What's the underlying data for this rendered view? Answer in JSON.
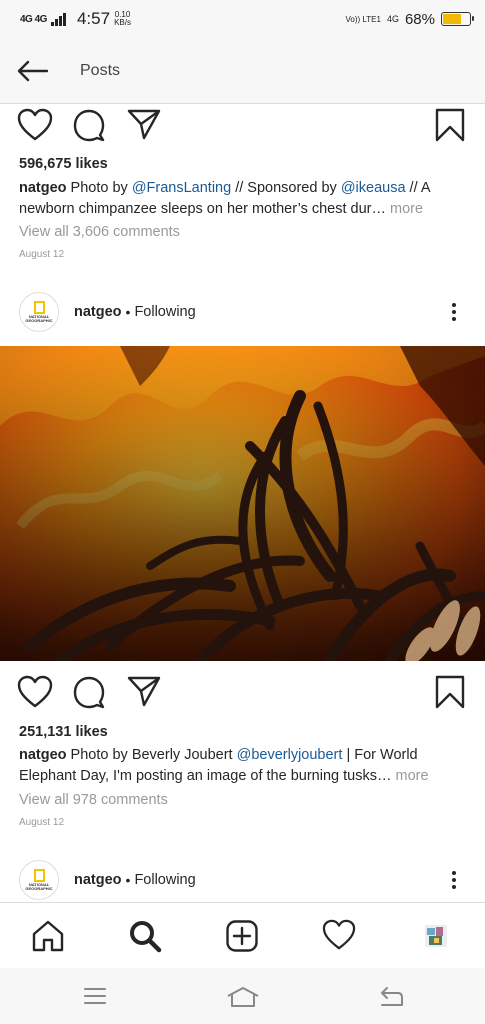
{
  "status_bar": {
    "network_left": "4G 4G",
    "time": "4:57",
    "speed_value": "0.10",
    "speed_unit": "KB/s",
    "volte": "Vo)) LTE1",
    "network_right": "4G",
    "battery_percent": "68%",
    "battery_level": 0.68,
    "battery_color": "#f5b800"
  },
  "header": {
    "back_icon": "back-arrow-icon",
    "title": "Posts"
  },
  "post1": {
    "icons": [
      "heart-icon",
      "comment-icon",
      "share-icon",
      "bookmark-icon"
    ],
    "likes": "596,675 likes",
    "username": "natgeo",
    "caption_1": " Photo by ",
    "mention_1": "@FransLanting",
    "caption_2": " // Sponsored by ",
    "mention_2": "@ikeausa",
    "caption_3": " // A newborn chimpanzee sleeps on her mother’s chest dur… ",
    "more": "more",
    "comments": "View all 3,606 comments",
    "date": "August 12"
  },
  "post2": {
    "username": "natgeo",
    "separator": "•",
    "follow_status": "Following",
    "avatar_text": "NATIONAL GEOGRAPHIC",
    "image_description_icon": "burning-tusks-photo",
    "icons": [
      "heart-icon",
      "comment-icon",
      "share-icon",
      "bookmark-icon"
    ],
    "likes": "251,131 likes",
    "caption_1": " Photo by Beverly Joubert ",
    "mention_1": "@beverlyjoubert",
    "caption_2": " | For World Elephant Day, I'm posting an image of the burning tusks… ",
    "more": "more",
    "comments": "View all 978 comments",
    "date": "August 12"
  },
  "post3": {
    "username": "natgeo",
    "separator": "•",
    "follow_status": "Following",
    "avatar_text": "NATIONAL GEOGRAPHIC"
  },
  "bottom_nav": [
    "home-icon",
    "search-icon",
    "add-post-icon",
    "activity-heart-icon",
    "profile-avatar-icon"
  ],
  "system_nav": [
    "menu-icon",
    "home-outline-icon",
    "back-return-icon"
  ],
  "colors": {
    "link": "#1a5b96",
    "muted": "#999999",
    "brand_yellow": "#f5c400"
  }
}
